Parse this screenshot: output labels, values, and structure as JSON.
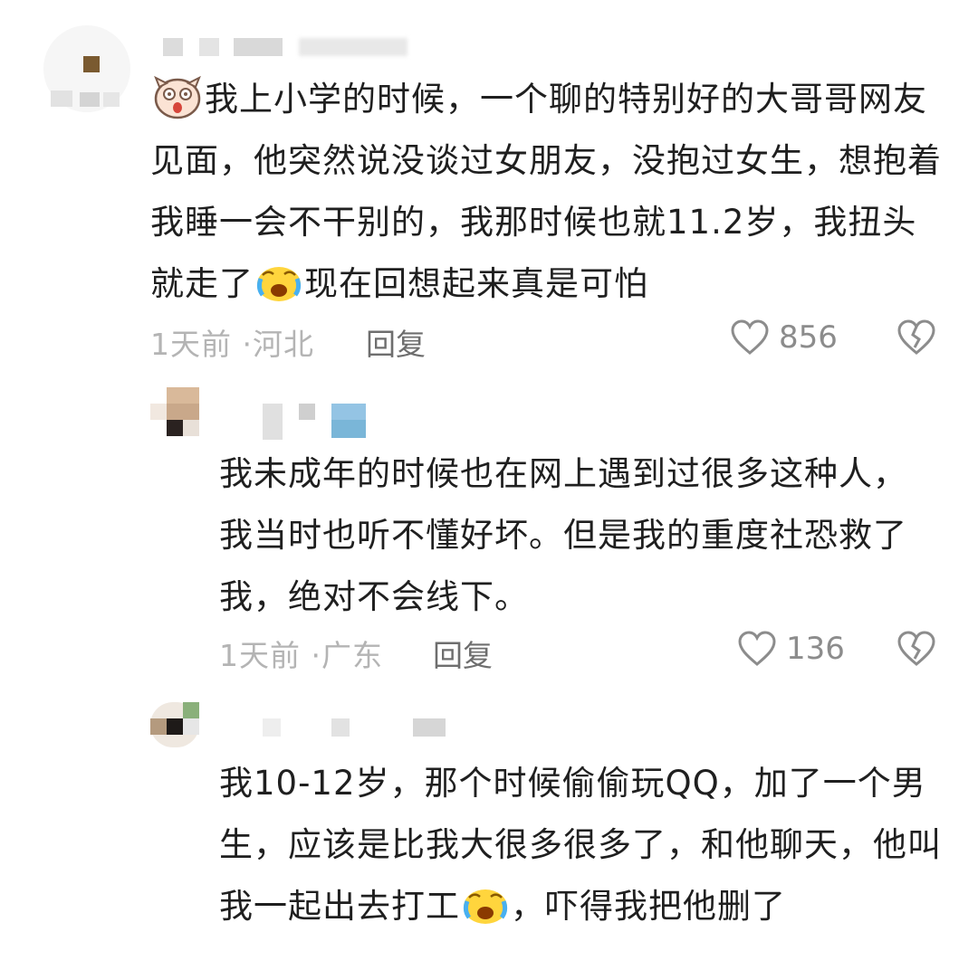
{
  "comments": [
    {
      "username": "▪ ▪ ▪ 宝贝",
      "text_parts": [
        "我上小学的时候，一个聊的特别好的大哥哥网友见面，他突然说没谈过女朋友，没抱过女生，想抱着我睡一会不干别的，我那时候也就11.2岁，我扭头就走了",
        "现在回想起来真是可怕"
      ],
      "time": "1天前",
      "location": "河北",
      "reply_label": "回复",
      "likes": "856",
      "lead_emoji": "shocked-face-icon",
      "inline_emoji": "crying-face-icon"
    },
    {
      "username": "",
      "text_parts": [
        "我未成年的时候也在网上遇到过很多这种人，我当时也听不懂好坏。但是我的重度社恐救了我，绝对不会线下。"
      ],
      "time": "1天前",
      "location": "广东",
      "reply_label": "回复",
      "likes": "136"
    },
    {
      "username": "",
      "text_parts": [
        "我10-12岁，那个时候偷偷玩QQ，加了一个男生，应该是比我大很多很多了，和他聊天，他叫我一起出去打工",
        "，吓得我把他删了"
      ],
      "inline_emoji": "crying-face-icon"
    }
  ],
  "separator": "·"
}
